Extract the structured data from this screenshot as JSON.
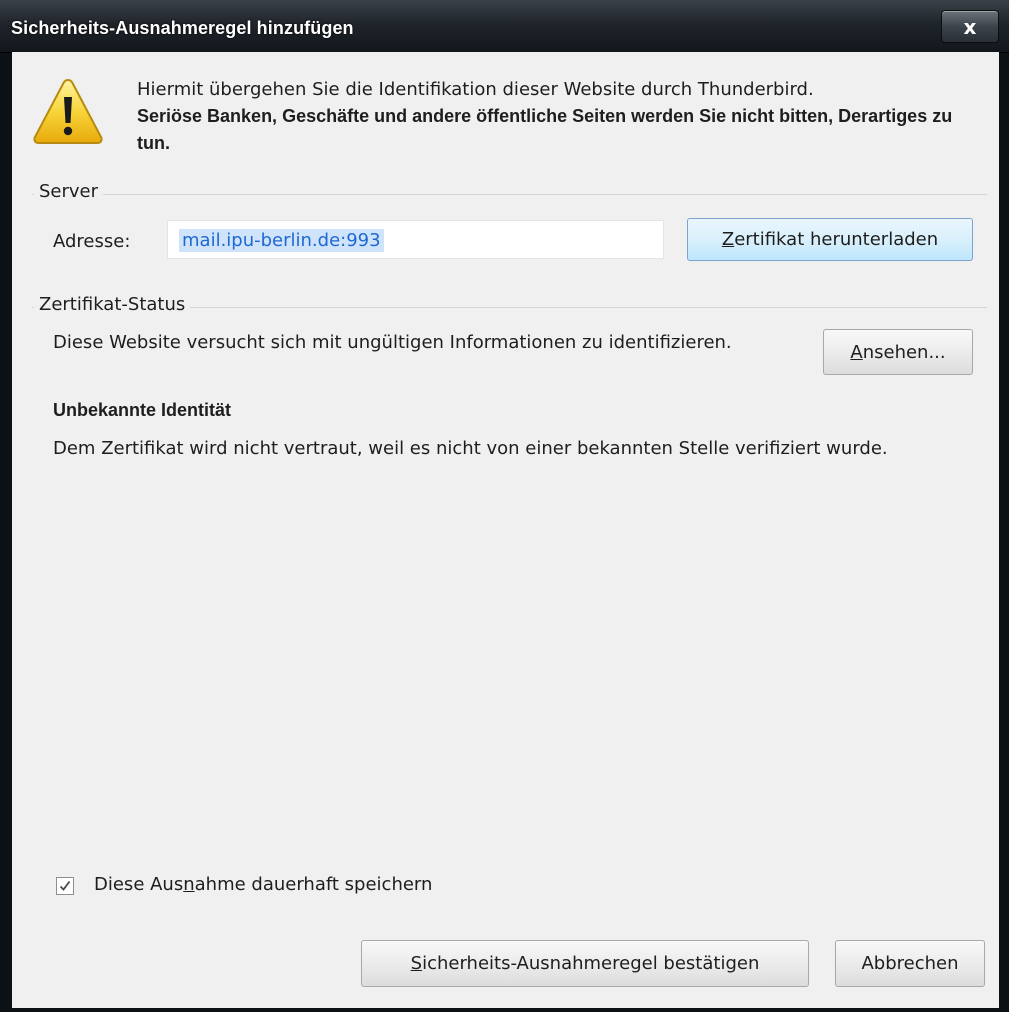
{
  "window": {
    "title": "Sicherheits-Ausnahmeregel hinzufügen",
    "close_label": "x"
  },
  "intro": {
    "line1": "Hiermit übergehen Sie die Identifikation dieser Website durch Thunderbird.",
    "warning": "Seriöse Banken, Geschäfte und andere öffentliche Seiten werden Sie nicht bitten, Derartiges zu tun."
  },
  "server": {
    "legend": "Server",
    "address_label": "Adresse:",
    "address_value": "mail.ipu-berlin.de:993",
    "download_button": {
      "accel": "Z",
      "rest": "ertifikat herunterladen"
    }
  },
  "status": {
    "legend": "Zertifikat-Status",
    "description": "Diese Website versucht sich mit ungültigen Informationen zu identifizieren.",
    "view_button": {
      "accel": "A",
      "rest": "nsehen..."
    },
    "heading": "Unbekannte Identität",
    "detail": "Dem Zertifikat wird nicht vertraut, weil es nicht von einer bekannten Stelle verifiziert wurde."
  },
  "permanent": {
    "checked": true,
    "label_pre": "Diese Aus",
    "label_accel": "n",
    "label_post": "ahme dauerhaft speichern"
  },
  "footer": {
    "confirm_button": {
      "accel": "S",
      "rest": "icherheits-Ausnahmeregel bestätigen"
    },
    "cancel_button": "Abbrechen"
  },
  "icons": {
    "warning": "warning-triangle-icon",
    "close": "close-icon",
    "check": "checkmark-icon"
  }
}
